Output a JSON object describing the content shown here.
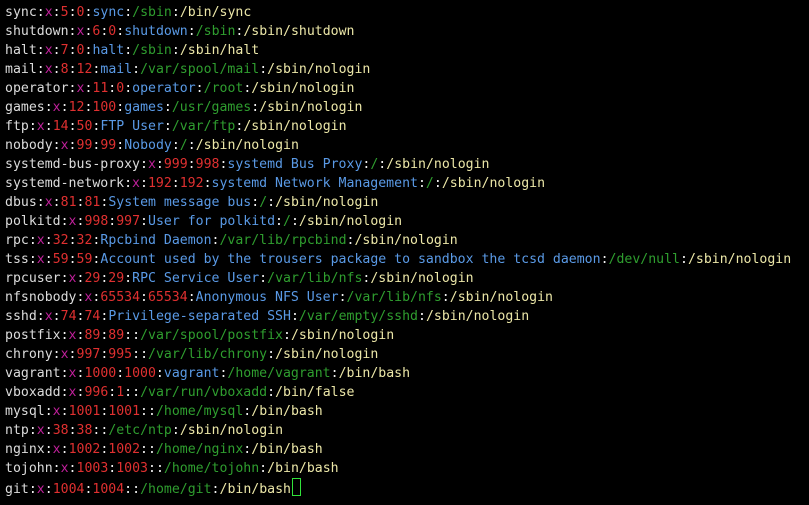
{
  "terminal": {
    "colors": {
      "background": "#000000",
      "username": "#dcdcdc",
      "separator": "#f2f2f2",
      "password": "#c0209b",
      "uid_gid": "#e03030",
      "gecos": "#5a9ae6",
      "home": "#2f9e2f",
      "shell": "#ece7a8",
      "cursor": "#31e23a"
    },
    "lines": [
      {
        "user": "sync",
        "pass": "x",
        "uid": "5",
        "gid": "0",
        "gecos": "sync",
        "home": "/sbin",
        "shell": "/bin/sync"
      },
      {
        "user": "shutdown",
        "pass": "x",
        "uid": "6",
        "gid": "0",
        "gecos": "shutdown",
        "home": "/sbin",
        "shell": "/sbin/shutdown"
      },
      {
        "user": "halt",
        "pass": "x",
        "uid": "7",
        "gid": "0",
        "gecos": "halt",
        "home": "/sbin",
        "shell": "/sbin/halt"
      },
      {
        "user": "mail",
        "pass": "x",
        "uid": "8",
        "gid": "12",
        "gecos": "mail",
        "home": "/var/spool/mail",
        "shell": "/sbin/nologin"
      },
      {
        "user": "operator",
        "pass": "x",
        "uid": "11",
        "gid": "0",
        "gecos": "operator",
        "home": "/root",
        "shell": "/sbin/nologin"
      },
      {
        "user": "games",
        "pass": "x",
        "uid": "12",
        "gid": "100",
        "gecos": "games",
        "home": "/usr/games",
        "shell": "/sbin/nologin"
      },
      {
        "user": "ftp",
        "pass": "x",
        "uid": "14",
        "gid": "50",
        "gecos": "FTP User",
        "home": "/var/ftp",
        "shell": "/sbin/nologin"
      },
      {
        "user": "nobody",
        "pass": "x",
        "uid": "99",
        "gid": "99",
        "gecos": "Nobody",
        "home": "/",
        "shell": "/sbin/nologin"
      },
      {
        "user": "systemd-bus-proxy",
        "pass": "x",
        "uid": "999",
        "gid": "998",
        "gecos": "systemd Bus Proxy",
        "home": "/",
        "shell": "/sbin/nologin"
      },
      {
        "user": "systemd-network",
        "pass": "x",
        "uid": "192",
        "gid": "192",
        "gecos": "systemd Network Management",
        "home": "/",
        "shell": "/sbin/nologin"
      },
      {
        "user": "dbus",
        "pass": "x",
        "uid": "81",
        "gid": "81",
        "gecos": "System message bus",
        "home": "/",
        "shell": "/sbin/nologin"
      },
      {
        "user": "polkitd",
        "pass": "x",
        "uid": "998",
        "gid": "997",
        "gecos": "User for polkitd",
        "home": "/",
        "shell": "/sbin/nologin"
      },
      {
        "user": "rpc",
        "pass": "x",
        "uid": "32",
        "gid": "32",
        "gecos": "Rpcbind Daemon",
        "home": "/var/lib/rpcbind",
        "shell": "/sbin/nologin"
      },
      {
        "user": "tss",
        "pass": "x",
        "uid": "59",
        "gid": "59",
        "gecos": "Account used by the trousers package to sandbox the tcsd daemon",
        "home": "/dev/null",
        "shell": "/sbin/nologin"
      },
      {
        "user": "rpcuser",
        "pass": "x",
        "uid": "29",
        "gid": "29",
        "gecos": "RPC Service User",
        "home": "/var/lib/nfs",
        "shell": "/sbin/nologin"
      },
      {
        "user": "nfsnobody",
        "pass": "x",
        "uid": "65534",
        "gid": "65534",
        "gecos": "Anonymous NFS User",
        "home": "/var/lib/nfs",
        "shell": "/sbin/nologin"
      },
      {
        "user": "sshd",
        "pass": "x",
        "uid": "74",
        "gid": "74",
        "gecos": "Privilege-separated SSH",
        "home": "/var/empty/sshd",
        "shell": "/sbin/nologin"
      },
      {
        "user": "postfix",
        "pass": "x",
        "uid": "89",
        "gid": "89",
        "gecos": "",
        "home": "/var/spool/postfix",
        "shell": "/sbin/nologin"
      },
      {
        "user": "chrony",
        "pass": "x",
        "uid": "997",
        "gid": "995",
        "gecos": "",
        "home": "/var/lib/chrony",
        "shell": "/sbin/nologin"
      },
      {
        "user": "vagrant",
        "pass": "x",
        "uid": "1000",
        "gid": "1000",
        "gecos": "vagrant",
        "home": "/home/vagrant",
        "shell": "/bin/bash"
      },
      {
        "user": "vboxadd",
        "pass": "x",
        "uid": "996",
        "gid": "1",
        "gecos": "",
        "home": "/var/run/vboxadd",
        "shell": "/bin/false"
      },
      {
        "user": "mysql",
        "pass": "x",
        "uid": "1001",
        "gid": "1001",
        "gecos": "",
        "home": "/home/mysql",
        "shell": "/bin/bash"
      },
      {
        "user": "ntp",
        "pass": "x",
        "uid": "38",
        "gid": "38",
        "gecos": "",
        "home": "/etc/ntp",
        "shell": "/sbin/nologin"
      },
      {
        "user": "nginx",
        "pass": "x",
        "uid": "1002",
        "gid": "1002",
        "gecos": "",
        "home": "/home/nginx",
        "shell": "/bin/bash"
      },
      {
        "user": "tojohn",
        "pass": "x",
        "uid": "1003",
        "gid": "1003",
        "gecos": "",
        "home": "/home/tojohn",
        "shell": "/bin/bash"
      },
      {
        "user": "git",
        "pass": "x",
        "uid": "1004",
        "gid": "1004",
        "gecos": "",
        "home": "/home/git",
        "shell": "/bin/bash"
      }
    ]
  }
}
